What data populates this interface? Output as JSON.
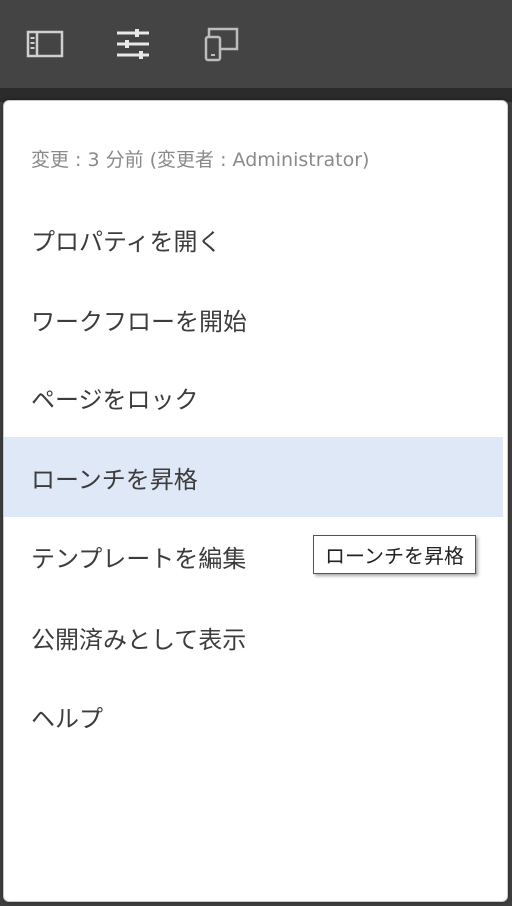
{
  "toolbar": {
    "icons": [
      "sidebar-toggle-icon",
      "adjust-sliders-icon",
      "device-emulator-icon"
    ],
    "background": "#444444"
  },
  "menu": {
    "meta_text": "変更 : 3 分前 (変更者 : Administrator)",
    "items": [
      {
        "label": "プロパティを開く"
      },
      {
        "label": "ワークフローを開始"
      },
      {
        "label": "ページをロック"
      },
      {
        "label": "ローンチを昇格",
        "active": true
      },
      {
        "label": "テンプレートを編集"
      },
      {
        "label": "公開済みとして表示"
      },
      {
        "label": "ヘルプ"
      }
    ],
    "highlight_color": "#dfe8f6"
  },
  "tooltip": {
    "text": "ローンチを昇格"
  }
}
